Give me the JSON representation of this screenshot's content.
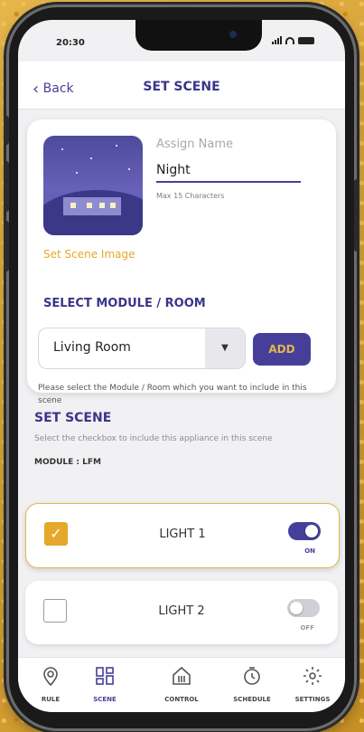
{
  "status": {
    "time": "20:30"
  },
  "header": {
    "back_label": "Back",
    "title": "SET SCENE"
  },
  "assign": {
    "label": "Assign Name",
    "value": "Night",
    "hint": "Max 15 Characters",
    "set_image_label": "Set Scene Image"
  },
  "module_select": {
    "title": "SELECT MODULE / ROOM",
    "selected": "Living Room",
    "add_label": "ADD",
    "hint": "Please select the Module / Room which you want to include in this scene"
  },
  "set_scene": {
    "title": "SET SCENE",
    "description": "Select the checkbox to include this appliance in this scene",
    "module_label": "MODULE : LFM"
  },
  "lights": [
    {
      "name": "LIGHT 1",
      "checked": true,
      "state": "ON",
      "check_glyph": "✓"
    },
    {
      "name": "LIGHT 2",
      "checked": false,
      "state": "OFF",
      "check_glyph": ""
    }
  ],
  "tabs": [
    {
      "label": "RULE",
      "icon": "location-pin-icon"
    },
    {
      "label": "SCENE",
      "icon": "scene-icon",
      "active": true
    },
    {
      "label": "CONTROL",
      "icon": "control-house-icon"
    },
    {
      "label": "SCHEDULE",
      "icon": "clock-icon"
    },
    {
      "label": "SETTINGS",
      "icon": "gear-icon"
    }
  ],
  "colors": {
    "primary": "#463f9a",
    "accent": "#e6a82a",
    "off_toggle": "#cfcfd6"
  }
}
